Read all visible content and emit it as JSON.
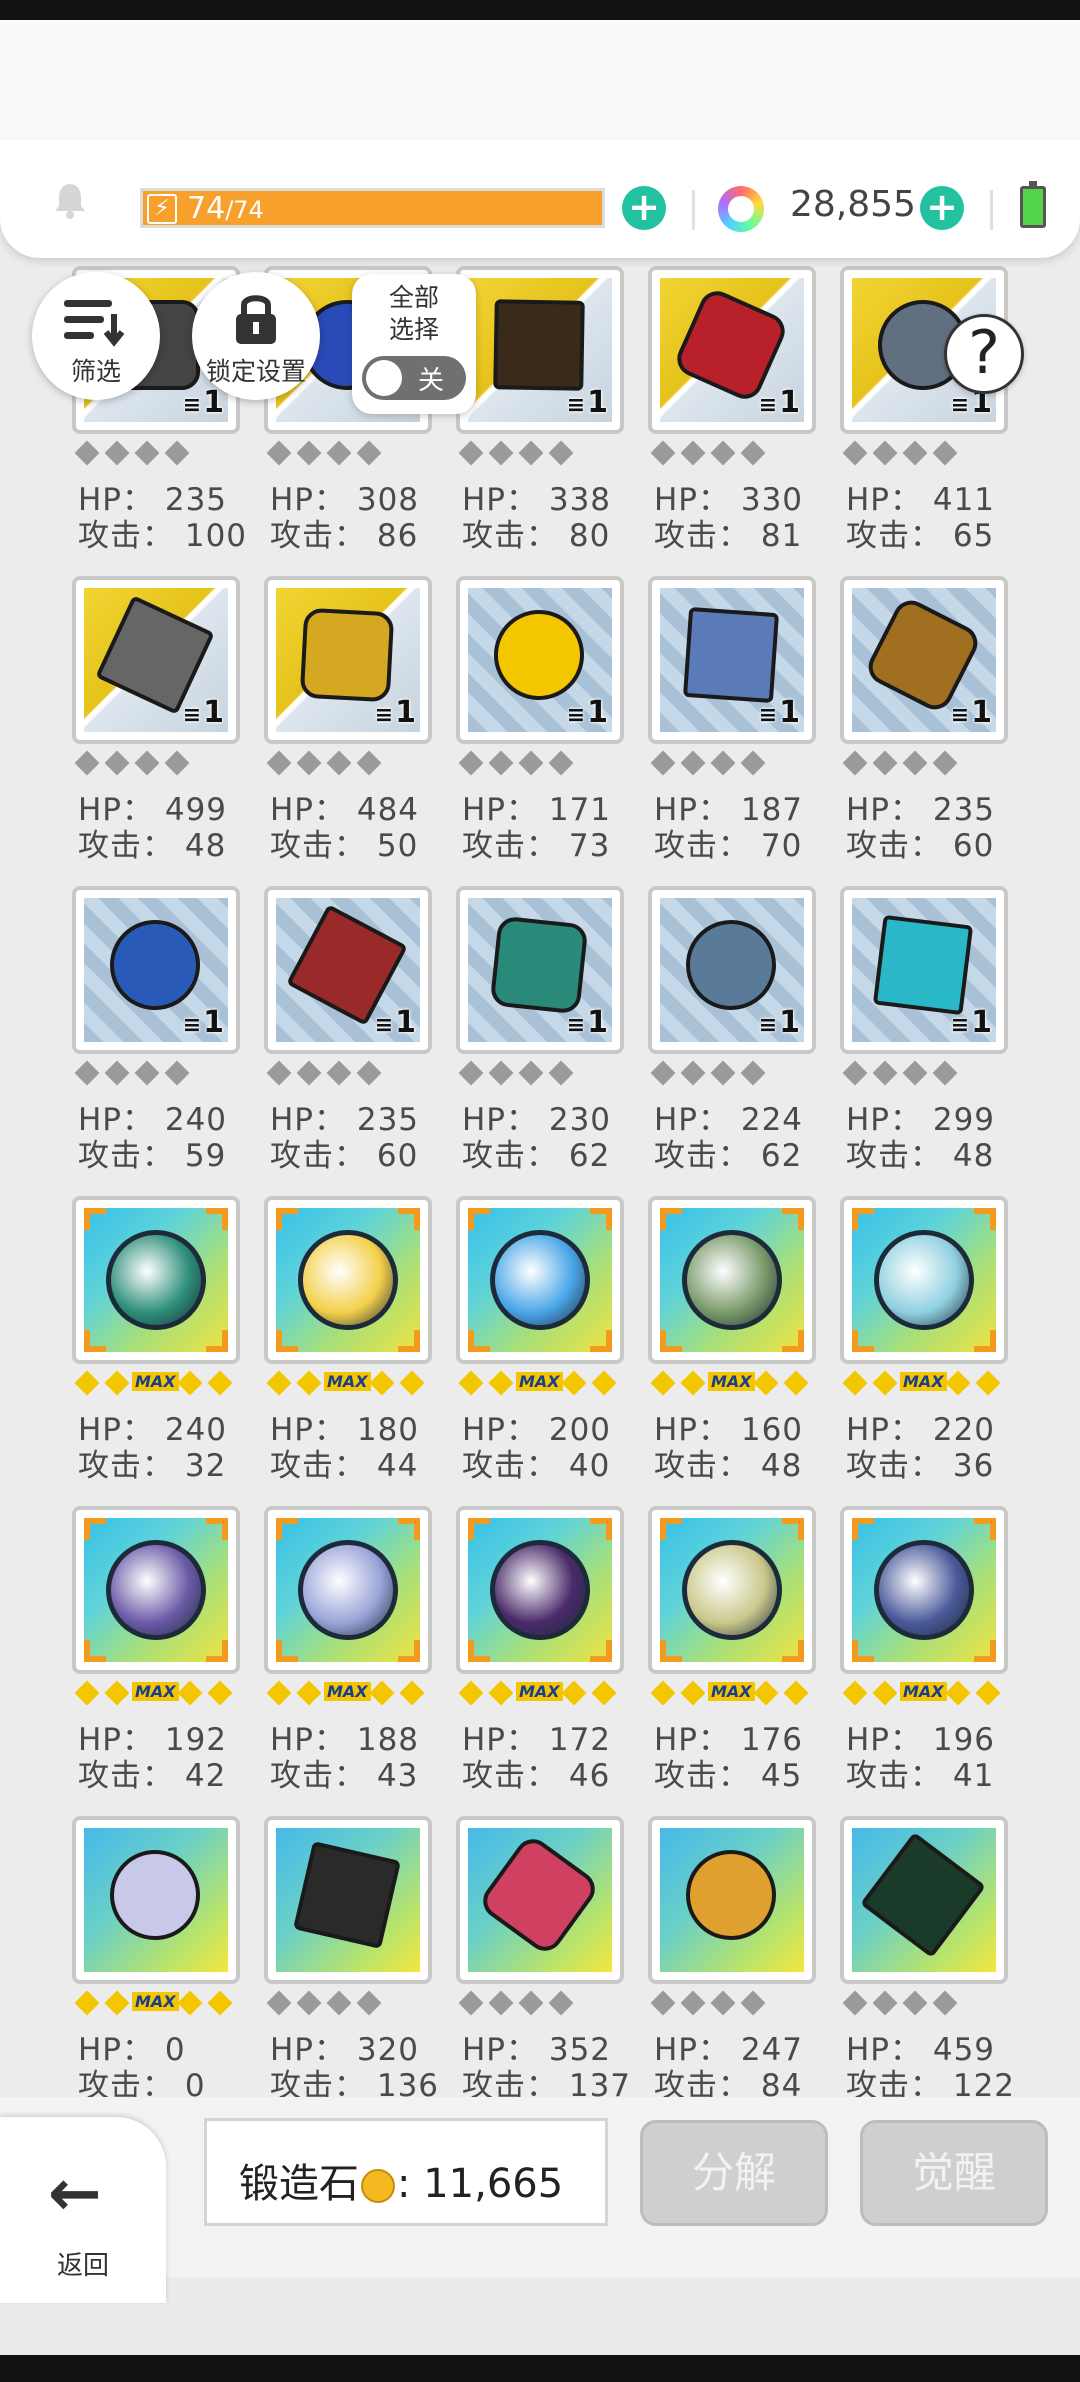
{
  "header": {
    "energy_value": "74",
    "energy_max": "/74",
    "gem_count": "28,855"
  },
  "floating": {
    "filter_label": "筛选",
    "lock_label": "锁定设置",
    "select_all_line1": "全部",
    "select_all_line2": "选择",
    "toggle_state": "关",
    "help_glyph": "?"
  },
  "labels": {
    "hp": "HP：",
    "attack": "攻击："
  },
  "items": [
    {
      "hp": "235",
      "atk": "100",
      "count": "1",
      "stars": 0
    },
    {
      "hp": "308",
      "atk": "86",
      "count": "1",
      "stars": 0
    },
    {
      "hp": "338",
      "atk": "80",
      "count": "1",
      "stars": 0
    },
    {
      "hp": "330",
      "atk": "81",
      "count": "1",
      "stars": 0
    },
    {
      "hp": "411",
      "atk": "65",
      "count": "1",
      "stars": 0
    },
    {
      "hp": "499",
      "atk": "48",
      "count": "1",
      "stars": 0
    },
    {
      "hp": "484",
      "atk": "50",
      "count": "1",
      "stars": 0
    },
    {
      "hp": "171",
      "atk": "73",
      "count": "1",
      "stars": 0
    },
    {
      "hp": "187",
      "atk": "70",
      "count": "1",
      "stars": 0
    },
    {
      "hp": "235",
      "atk": "60",
      "count": "1",
      "stars": 0
    },
    {
      "hp": "240",
      "atk": "59",
      "count": "1",
      "stars": 0
    },
    {
      "hp": "235",
      "atk": "60",
      "count": "1",
      "stars": 0
    },
    {
      "hp": "230",
      "atk": "62",
      "count": "1",
      "stars": 0
    },
    {
      "hp": "224",
      "atk": "62",
      "count": "1",
      "stars": 0
    },
    {
      "hp": "299",
      "atk": "48",
      "count": "1",
      "stars": 0
    },
    {
      "hp": "240",
      "atk": "32",
      "count": "",
      "stars": 4
    },
    {
      "hp": "180",
      "atk": "44",
      "count": "",
      "stars": 4
    },
    {
      "hp": "200",
      "atk": "40",
      "count": "",
      "stars": 4
    },
    {
      "hp": "160",
      "atk": "48",
      "count": "",
      "stars": 4
    },
    {
      "hp": "220",
      "atk": "36",
      "count": "",
      "stars": 4
    },
    {
      "hp": "192",
      "atk": "42",
      "count": "",
      "stars": 4
    },
    {
      "hp": "188",
      "atk": "43",
      "count": "",
      "stars": 4
    },
    {
      "hp": "172",
      "atk": "46",
      "count": "",
      "stars": 4
    },
    {
      "hp": "176",
      "atk": "45",
      "count": "",
      "stars": 4
    },
    {
      "hp": "196",
      "atk": "41",
      "count": "",
      "stars": 4
    },
    {
      "hp": "0",
      "atk": "0",
      "count": "",
      "stars": 4
    },
    {
      "hp": "320",
      "atk": "136",
      "count": "",
      "stars": 0
    },
    {
      "hp": "352",
      "atk": "137",
      "count": "",
      "stars": 0
    },
    {
      "hp": "247",
      "atk": "84",
      "count": "",
      "stars": 0
    },
    {
      "hp": "459",
      "atk": "122",
      "count": "",
      "stars": 0
    }
  ],
  "max_tag": "MAX",
  "bottom": {
    "back_label": "返回",
    "stone_label": "锻造石",
    "stone_value": "11,665",
    "decompose_label": "分解",
    "awaken_label": "觉醒"
  },
  "colors": {
    "energy": "#f7a02b",
    "plus": "#22c2a1",
    "star_gold": "#f3c600",
    "star_gray": "#9a9a9a"
  }
}
